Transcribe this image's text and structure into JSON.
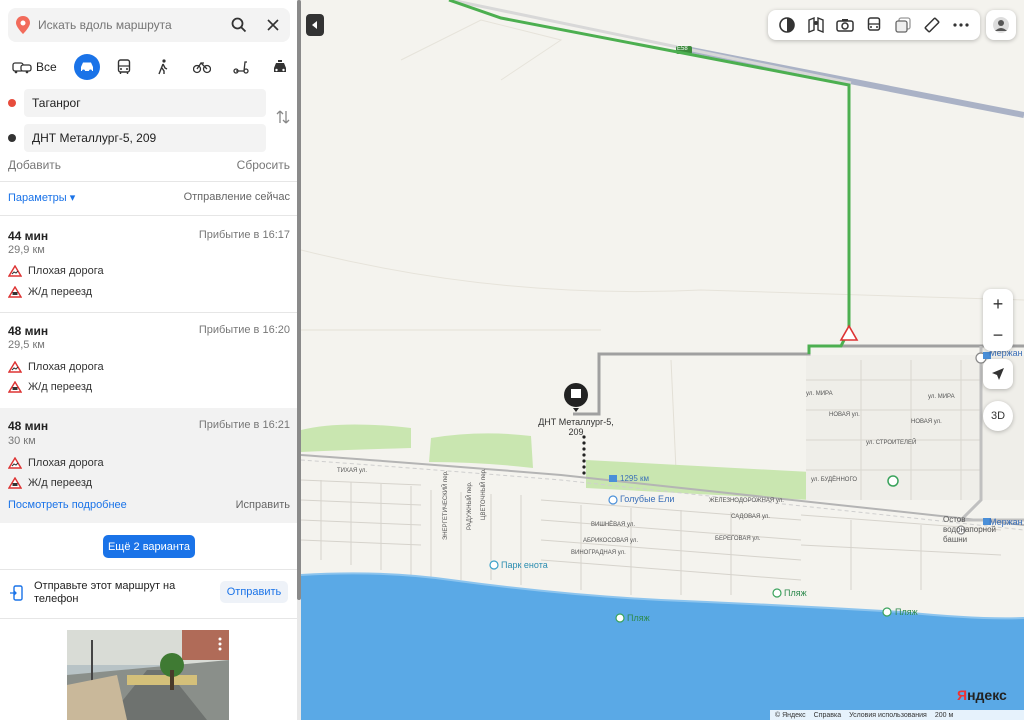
{
  "search": {
    "placeholder": "Искать вдоль маршрута"
  },
  "modes": {
    "all_label": "Все"
  },
  "route_points": {
    "from": "Таганрог",
    "to": "ДНТ Металлург-5, 209"
  },
  "actions": {
    "add": "Добавить",
    "reset": "Сбросить"
  },
  "params": {
    "label": "Параметры ▾",
    "departure": "Отправление сейчас"
  },
  "routes": [
    {
      "duration": "44 мин",
      "arrival": "Прибытие в 16:17",
      "distance": "29,9 км",
      "warnings": [
        "Плохая дорога",
        "Ж/д переезд"
      ]
    },
    {
      "duration": "48 мин",
      "arrival": "Прибытие в 16:20",
      "distance": "29,5 км",
      "warnings": [
        "Плохая дорога",
        "Ж/д переезд"
      ]
    },
    {
      "duration": "48 мин",
      "arrival": "Прибытие в 16:21",
      "distance": "30 км",
      "warnings": [
        "Плохая дорога",
        "Ж/д переезд"
      ],
      "more": "Посмотреть подробнее",
      "fix": "Исправить"
    }
  ],
  "more_variants": "Ещё 2 варианта",
  "send": {
    "text": "Отправьте этот маршрут на телефон",
    "button": "Отправить"
  },
  "map": {
    "destination_label": "ДНТ Металлург-5, 209",
    "highway_shield": "E58",
    "km_label": "1295 км",
    "station_golubye": "Голубые Ели",
    "park": "Парк енота",
    "beach": "Пляж",
    "merzhan": "Мержан",
    "ostov": "Остов водонапорной башни",
    "streets": {
      "tikhaya": "ТИХАЯ ул.",
      "zheleznodorozhnaya": "ЖЕЛЕЗНОДОРОЖНАЯ ул.",
      "sadovaya": "САДОВАЯ ул.",
      "beregovaya": "БЕРЕГОВАЯ ул.",
      "vishnevaya": "ВИШНЁВАЯ ул.",
      "abrikosovaya": "АБРИКОСОВАЯ ул.",
      "vinogradnaya": "ВИНОГРАДНАЯ ул.",
      "mira": "ул. МИРА",
      "novaya": "НОВАЯ ул.",
      "stroiteley": "ул. СТРОИТЕЛЕЙ",
      "budennogo": "ул. БУДЁННОГО",
      "energeticheskiy": "ЭНЕРГЕТИЧЕСКИЙ пер.",
      "raduzhny": "РАДУЖНЫЙ пер.",
      "tsvetochny": "ЦВЕТОЧНЫЙ пер."
    },
    "zoom_in": "+",
    "zoom_out": "−",
    "btn3d": "3D",
    "logo_main": "Я",
    "logo_rest": "ндекс",
    "footer": {
      "copyright": "© Яндекс",
      "help": "Справка",
      "terms": "Условия использования",
      "scale": "200 м"
    }
  },
  "colors": {
    "accent": "#1a73e8",
    "route_active": "#4caf50",
    "route_alt": "#a0a0a0",
    "water": "#5aa9e6",
    "green_area": "#c9e6b0"
  }
}
